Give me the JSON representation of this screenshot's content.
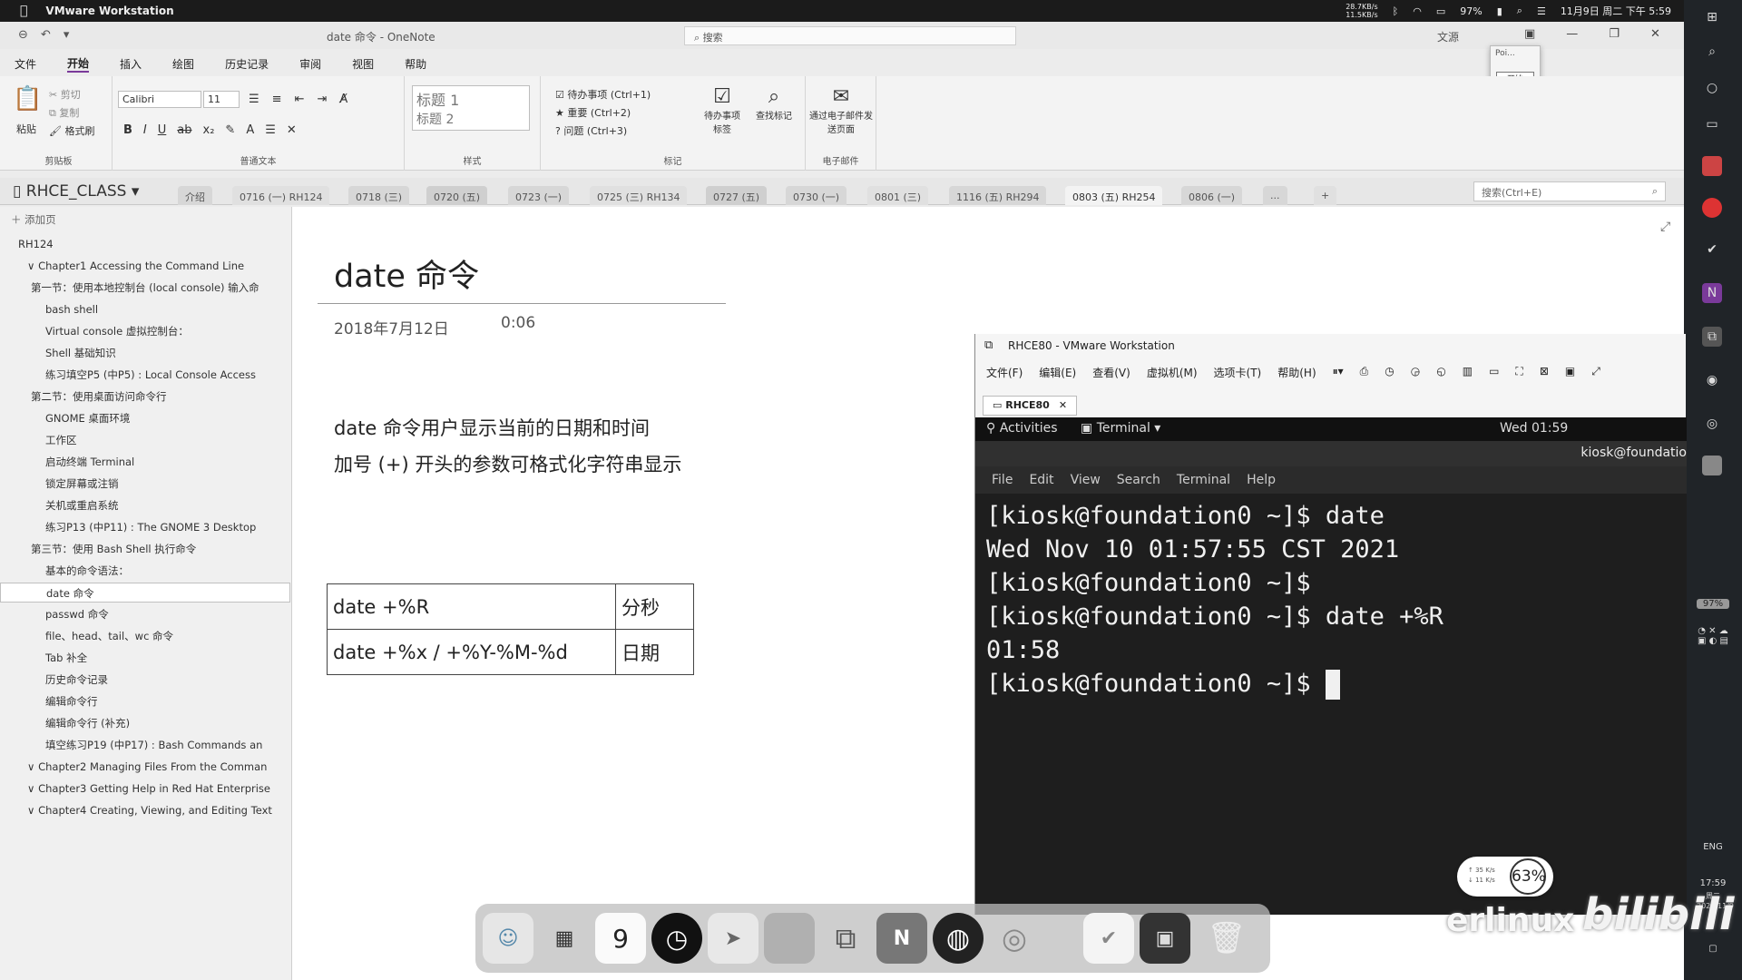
{
  "mac_menubar": {
    "app_name": "VMware Workstation",
    "net_up": "28.7KB/s",
    "net_down": "11.5KB/s",
    "battery": "97%",
    "datetime": "11月9日 周二 下午 5:59"
  },
  "onenote": {
    "doc_title": "date 命令 - OneNote",
    "search_placeholder": "搜索",
    "user": "文源",
    "popup_text": "Poi...",
    "popup_button": "开始",
    "ribbon_tabs": [
      "文件",
      "开始",
      "插入",
      "绘图",
      "历史记录",
      "审阅",
      "视图",
      "帮助"
    ],
    "ribbon": {
      "paste": "粘贴",
      "cut": "剪切",
      "copy": "复制",
      "format_painter": "格式刷",
      "clipboard_group": "剪贴板",
      "font_name": "Calibri",
      "font_size": "11",
      "basic_text_group": "普通文本",
      "style_h1": "标题 1",
      "style_h2": "标题 2",
      "styles_group": "样式",
      "tag_todo": "待办事项 (Ctrl+1)",
      "tag_important": "重要 (Ctrl+2)",
      "tag_question": "问题 (Ctrl+3)",
      "todo_tag_btn": "待办事项标签",
      "find_tags_btn": "查找标记",
      "tags_group": "标记",
      "email_btn": "通过电子邮件发送页面",
      "email_group": "电子邮件"
    },
    "notebook": "RHCE_CLASS",
    "section_tabs": [
      "介绍",
      "0716 (一) RH124",
      "0718 (三)",
      "0720 (五)",
      "0723 (一)",
      "0725 (三) RH134",
      "0727 (五)",
      "0730 (一)",
      "0801 (三)",
      "1116 (五) RH294",
      "0803 (五) RH254",
      "0806 (一)",
      "..."
    ],
    "add_section": "+",
    "notebook_search": "搜索(Ctrl+E)",
    "add_page": "添加页",
    "pages": [
      {
        "text": "RH124",
        "indent": 0
      },
      {
        "text": "∨ Chapter1 Accessing the Command Line",
        "indent": 1
      },
      {
        "text": "第一节：使用本地控制台 (local console) 输入命",
        "indent": 2
      },
      {
        "text": "bash shell",
        "indent": 3
      },
      {
        "text": "Virtual console 虚拟控制台：",
        "indent": 3
      },
      {
        "text": "Shell 基础知识",
        "indent": 3
      },
      {
        "text": "练习填空P5 (中P5) :  Local Console Access",
        "indent": 3
      },
      {
        "text": "第二节：使用桌面访问命令行",
        "indent": 2
      },
      {
        "text": "GNOME 桌面环境",
        "indent": 3
      },
      {
        "text": "工作区",
        "indent": 3
      },
      {
        "text": "启动终端 Terminal",
        "indent": 3
      },
      {
        "text": "锁定屏幕或注销",
        "indent": 3
      },
      {
        "text": "关机或重启系统",
        "indent": 3
      },
      {
        "text": "练习P13 (中P11) :   The GNOME 3 Desktop",
        "indent": 3
      },
      {
        "text": "第三节：使用 Bash Shell 执行命令",
        "indent": 2
      },
      {
        "text": "基本的命令语法：",
        "indent": 3
      },
      {
        "text": "date 命令",
        "indent": 3
      },
      {
        "text": "passwd 命令",
        "indent": 3
      },
      {
        "text": "file、head、tail、wc 命令",
        "indent": 3
      },
      {
        "text": "Tab 补全",
        "indent": 3
      },
      {
        "text": "历史命令记录",
        "indent": 3
      },
      {
        "text": "编辑命令行",
        "indent": 3
      },
      {
        "text": "编辑命令行 (补充)",
        "indent": 3
      },
      {
        "text": "填空练习P19 (中P17) :   Bash Commands an",
        "indent": 3
      },
      {
        "text": "∨ Chapter2 Managing Files From the Comman",
        "indent": 1
      },
      {
        "text": "∨ Chapter3 Getting Help in Red Hat Enterprise",
        "indent": 1
      },
      {
        "text": "∨ Chapter4 Creating, Viewing, and Editing Text",
        "indent": 1
      }
    ],
    "page": {
      "title": "date 命令",
      "date": "2018年7月12日",
      "time": "0:06",
      "line1": "date 命令用户显示当前的日期和时间",
      "line2": "加号 (+) 开头的参数可格式化字符串显示",
      "table": [
        [
          "date +%R",
          "分秒"
        ],
        [
          "date +%x  /  +%Y-%M-%d",
          "日期"
        ]
      ]
    }
  },
  "vmware": {
    "title": "RHCE80 - VMware Workstation",
    "menu": [
      "文件(F)",
      "编辑(E)",
      "查看(V)",
      "虚拟机(M)",
      "选项卡(T)",
      "帮助(H)"
    ],
    "tab": "RHCE80",
    "guest": {
      "activities": "Activities",
      "terminal_menu": "Terminal ▾",
      "clock": "Wed 01:59",
      "window_title": "kiosk@foundatio",
      "term_menu": [
        "File",
        "Edit",
        "View",
        "Search",
        "Terminal",
        "Help"
      ],
      "lines": [
        "[kiosk@foundation0 ~]$ date",
        "Wed Nov 10 01:57:55 CST 2021",
        "[kiosk@foundation0 ~]$",
        "[kiosk@foundation0 ~]$ date +%R",
        "01:58",
        "[kiosk@foundation0 ~]$ "
      ]
    }
  },
  "dock": {
    "calendar_day": "9",
    "onenote_letter": "N",
    "icons": [
      "finder-icon",
      "launchpad-icon",
      "calendar-icon",
      "clock-icon",
      "swift-icon",
      "preview-icon",
      "parallels-icon",
      "onenote-icon",
      "obs-icon",
      "obs-studio-icon",
      "folder-icon",
      "screenshot-icon",
      "trash-icon"
    ]
  },
  "overlay": {
    "net_up": "↑ 35 K/s",
    "net_down": "↓ 11 K/s",
    "cpu": "63%",
    "brand": "erlinux",
    "bili": "bilibili"
  },
  "taskbar": {
    "battery": "97%",
    "lang": "ENG",
    "time": "17:59",
    "date": "2021/11/9",
    "weekday": "周二"
  }
}
